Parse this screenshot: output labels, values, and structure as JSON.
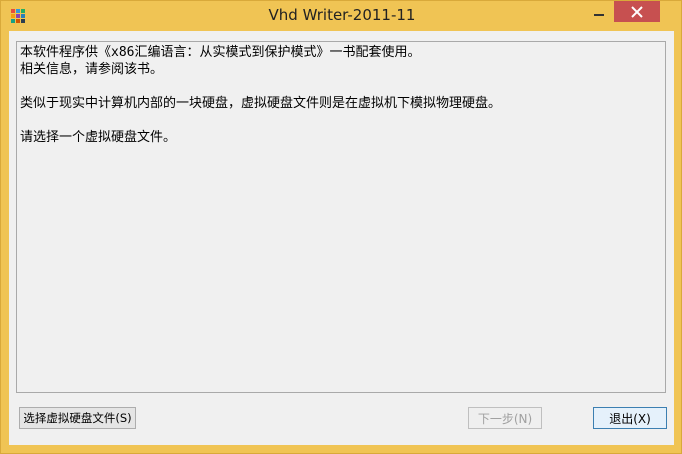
{
  "window": {
    "title": "Vhd Writer-2011-11",
    "colors": {
      "frame": "#f0c454",
      "close_button": "#c75050"
    }
  },
  "titlebar": {
    "app_icon": "colorful-grid-icon",
    "minimize_icon": "minimize-icon",
    "close_icon": "close-icon"
  },
  "info": {
    "lines": [
      "本软件程序供《x86汇编语言：从实模式到保护模式》一书配套使用。",
      "相关信息，请参阅该书。",
      "类似于现实中计算机内部的一块硬盘，虚拟硬盘文件则是在虚拟机下模拟物理硬盘。",
      "请选择一个虚拟硬盘文件。"
    ]
  },
  "buttons": {
    "select_file": "选择虚拟硬盘文件(S)",
    "next": "下一步(N)",
    "exit": "退出(X)"
  }
}
